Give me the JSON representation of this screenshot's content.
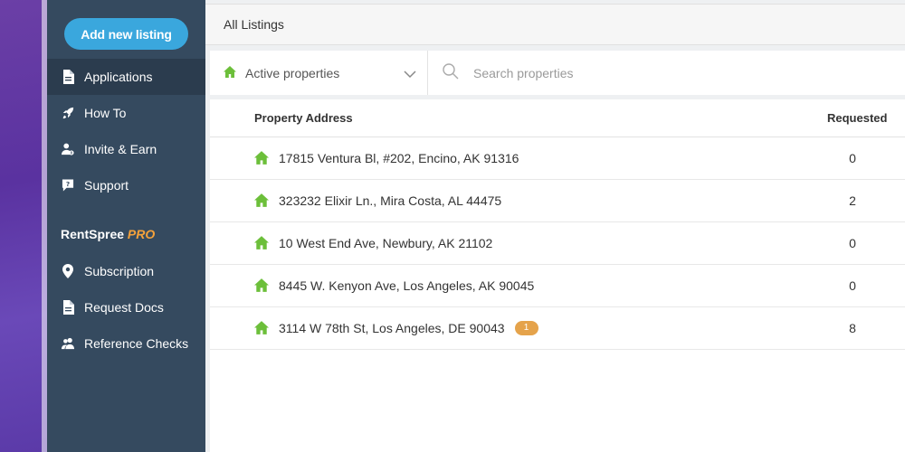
{
  "sidebar": {
    "add_button": "Add new listing",
    "items": [
      {
        "label": "Applications",
        "icon": "document-icon",
        "active": true
      },
      {
        "label": "How To",
        "icon": "rocket-icon"
      },
      {
        "label": "Invite & Earn",
        "icon": "invite-user-icon"
      },
      {
        "label": "Support",
        "icon": "help-chat-icon"
      }
    ],
    "pro_brand": "RentSpree",
    "pro_suffix": "PRO",
    "pro_items": [
      {
        "label": "Subscription",
        "icon": "location-pin-icon"
      },
      {
        "label": "Request Docs",
        "icon": "document-icon"
      },
      {
        "label": "Reference Checks",
        "icon": "users-icon"
      }
    ]
  },
  "header": {
    "title": "All Listings"
  },
  "filter": {
    "selected": "Active properties",
    "search_placeholder": "Search properties"
  },
  "table": {
    "columns": {
      "address": "Property Address",
      "requested": "Requested"
    },
    "rows": [
      {
        "address": "17815 Ventura Bl, #202, Encino, AK 91316",
        "requested": "0",
        "badge": ""
      },
      {
        "address": "323232 Elixir Ln., Mira Costa, AL 44475",
        "requested": "2",
        "badge": ""
      },
      {
        "address": "10 West End Ave, Newbury, AK 21102",
        "requested": "0",
        "badge": ""
      },
      {
        "address": "8445 W. Kenyon Ave, Los Angeles, AK 90045",
        "requested": "0",
        "badge": ""
      },
      {
        "address": "3114 W 78th St, Los Angeles, DE 90043",
        "requested": "8",
        "badge": "1"
      }
    ]
  },
  "colors": {
    "sidebar_bg": "#354a5f",
    "sidebar_active": "#2b3c4e",
    "button": "#3aa7dd",
    "pro_accent": "#f5a23b",
    "home_icon": "#6cbf3a",
    "badge": "#e5a34b"
  }
}
